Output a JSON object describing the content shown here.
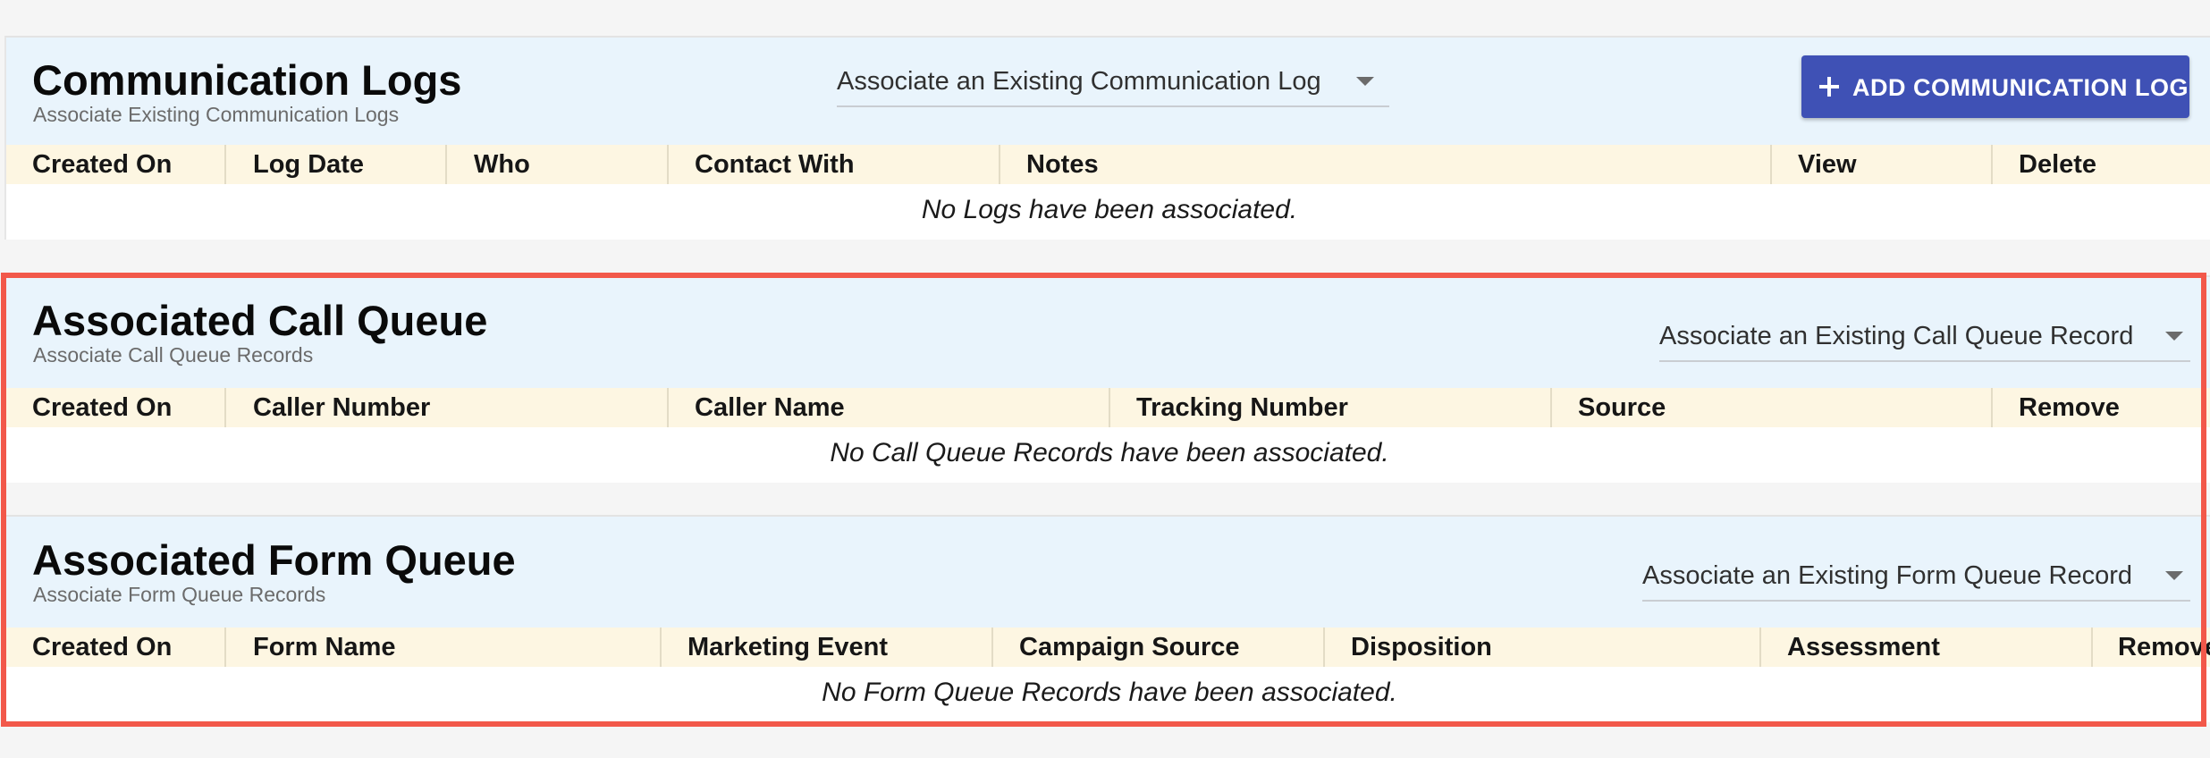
{
  "communication_logs": {
    "title": "Communication Logs",
    "subtitle": "Associate Existing Communication Logs",
    "select_value": "Associate an Existing Communication Log",
    "add_button_label": "ADD COMMUNICATION LOG",
    "columns": [
      "Created On",
      "Log Date",
      "Who",
      "Contact With",
      "Notes",
      "View",
      "Delete"
    ],
    "empty_message": "No Logs have been associated."
  },
  "call_queue": {
    "title": "Associated Call Queue",
    "subtitle": "Associate Call Queue Records",
    "select_value": "Associate an Existing Call Queue Record",
    "columns": [
      "Created On",
      "Caller Number",
      "Caller Name",
      "Tracking Number",
      "Source",
      "Remove"
    ],
    "empty_message": "No Call Queue Records have been associated."
  },
  "form_queue": {
    "title": "Associated Form Queue",
    "subtitle": "Associate Form Queue Records",
    "select_value": "Associate an Existing Form Queue Record",
    "columns": [
      "Created On",
      "Form Name",
      "Marketing Event",
      "Campaign Source",
      "Disposition",
      "Assessment",
      "Remove"
    ],
    "empty_message": "No Form Queue Records have been associated."
  },
  "colors": {
    "header_bg": "#e9f4fc",
    "table_header_bg": "#fdf6e2",
    "primary_button": "#3f51b5",
    "highlight_border": "#f2584a"
  }
}
